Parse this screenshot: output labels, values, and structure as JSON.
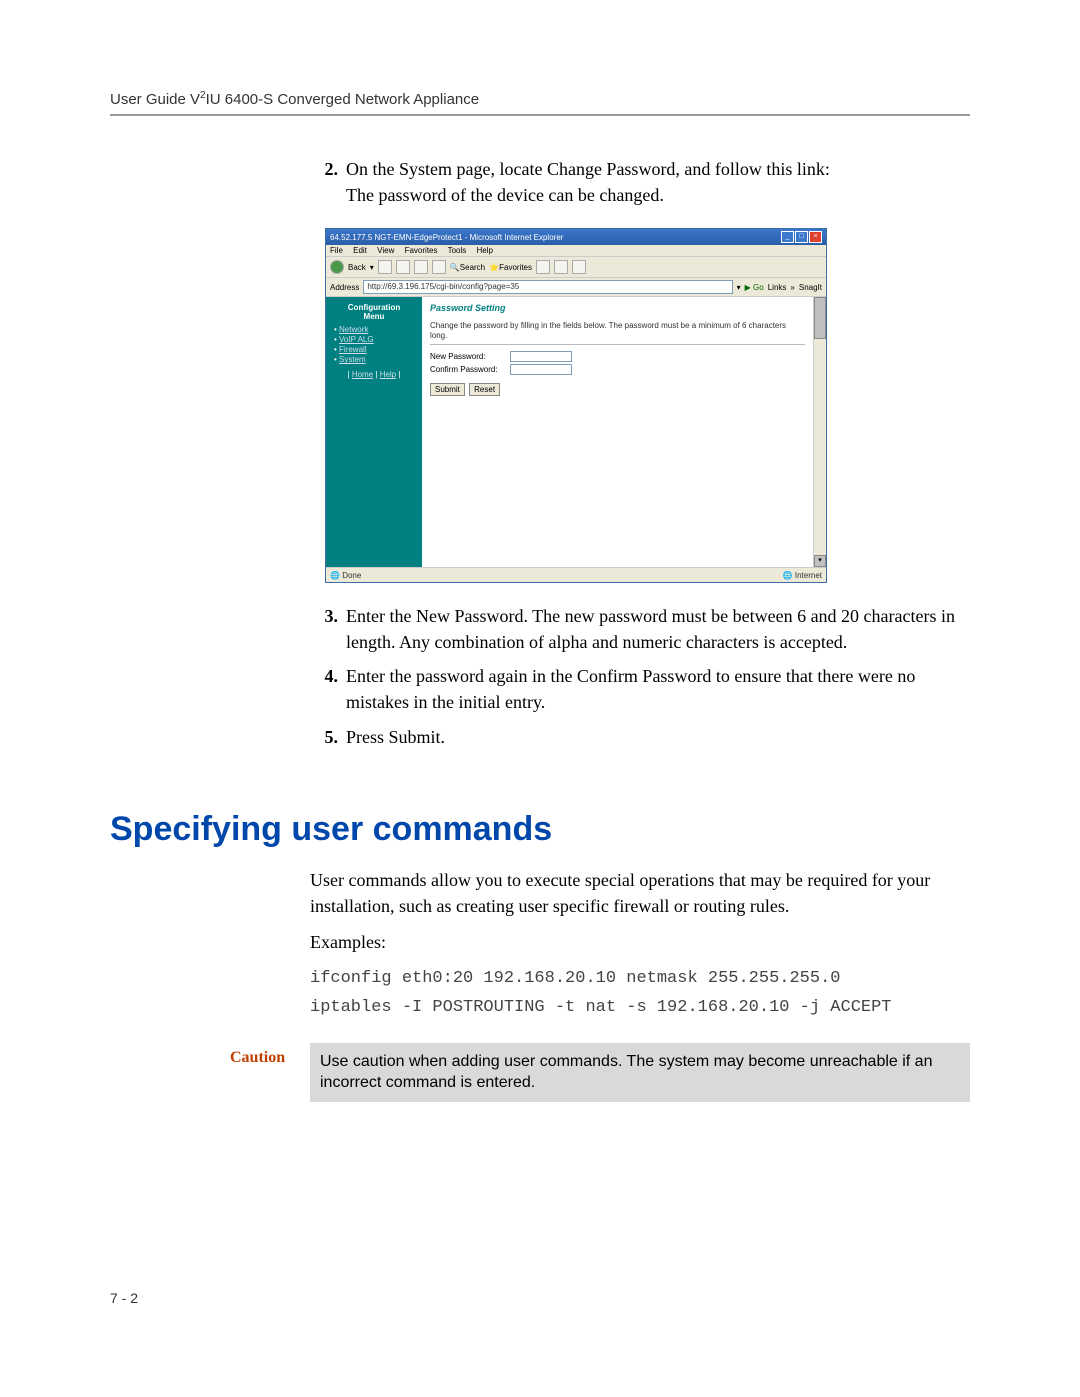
{
  "header": {
    "guide_prefix": "User Guide V",
    "guide_sup": "2",
    "guide_suffix": "IU 6400-S Converged Network Appliance"
  },
  "steps_top": [
    {
      "num": "2.",
      "text": "On the System page, locate Change Password, and follow this link:"
    }
  ],
  "step2_sub": "The password of the device can be changed.",
  "ie": {
    "title": "64.52.177.5 NGT-EMN-EdgeProtect1 - Microsoft Internet Explorer",
    "menus": [
      "File",
      "Edit",
      "View",
      "Favorites",
      "Tools",
      "Help"
    ],
    "back_label": "Back",
    "search_label": "Search",
    "fav_label": "Favorites",
    "addr_label": "Address",
    "url": "http://69.3.196.175/cgi-bin/config?page=35",
    "go": "Go",
    "links": "Links",
    "snagit": "SnagIt",
    "sidebar_title1": "Configuration",
    "sidebar_title2": "Menu",
    "sidebar_items": [
      "Network",
      "VoIP ALG",
      "Firewall",
      "System"
    ],
    "home": "Home",
    "help": "Help",
    "pw_title": "Password Setting",
    "pw_desc": "Change the password by filling in the fields below. The password must be a minimum of 6 characters long.",
    "new_pw": "New Password:",
    "confirm_pw": "Confirm Password:",
    "submit": "Submit",
    "reset": "Reset",
    "status_done": "Done",
    "status_net": "Internet"
  },
  "steps_bottom": [
    {
      "num": "3.",
      "text": "Enter the New Password. The new password must be between 6 and 20 characters in length. Any combination of alpha and numeric characters is accepted."
    },
    {
      "num": "4.",
      "text": "Enter the password again in the Confirm Password to ensure that there were no mistakes in the initial entry."
    },
    {
      "num": "5.",
      "text": "Press Submit."
    }
  ],
  "section_title": "Specifying user commands",
  "section_para": "User commands allow you to execute special operations that may be required for your installation, such as creating user specific firewall or routing rules.",
  "examples_label": "Examples:",
  "code_lines": [
    "ifconfig eth0:20 192.168.20.10 netmask 255.255.255.0",
    "iptables -I POSTROUTING -t nat -s 192.168.20.10 -j ACCEPT"
  ],
  "caution_label": "Caution",
  "caution_text": "Use caution when adding user commands. The system may become unreachable if an incorrect command is entered.",
  "page_number": "7 - 2"
}
